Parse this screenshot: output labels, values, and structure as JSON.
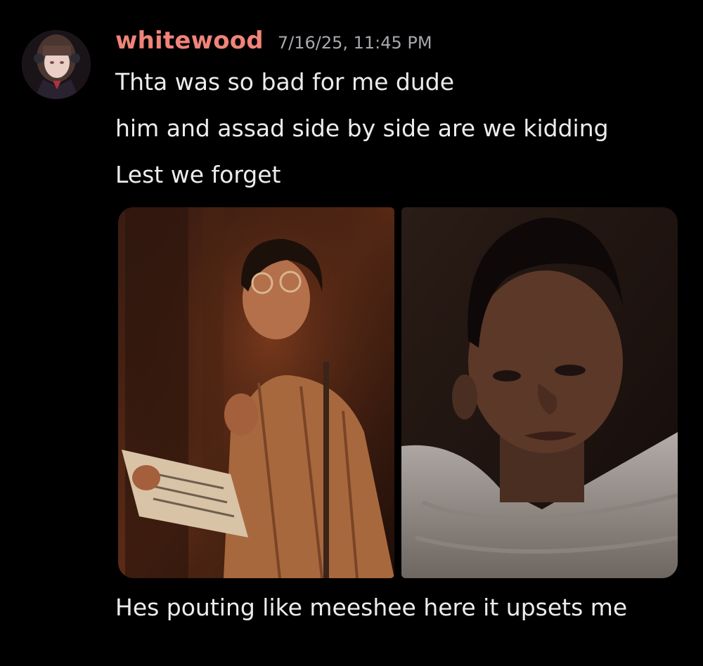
{
  "message": {
    "author": "whitewood",
    "timestamp": "7/16/25, 11:45 PM",
    "lines": [
      "Thta was so bad for me dude",
      "him and assad side by side are we kidding",
      "Lest we forget"
    ],
    "after_gallery": "Hes pouting like meeshee here it upsets me"
  },
  "attachments": [
    {
      "kind": "image",
      "subject": "man with glasses holding newspaper in warm dim light"
    },
    {
      "kind": "image",
      "subject": "man in close-up with light shirt, pensive expression"
    }
  ],
  "colors": {
    "background": "#000000",
    "username": "#f0837a",
    "timestamp": "#a7a8ae",
    "text": "#ececee"
  }
}
